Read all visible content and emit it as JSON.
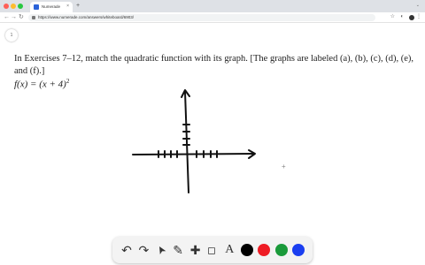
{
  "browser": {
    "tab_title": "Numerade",
    "tab_close": "×",
    "new_tab": "+",
    "url": "https://www.numerade.com/answers/whiteboard/6903/",
    "nav_back": "←",
    "nav_forward": "→",
    "nav_reload": "↻",
    "bookmark_star": "☆",
    "menu": "⋮"
  },
  "page": {
    "page_number": "1",
    "problem_text": "In Exercises 7–12, match the quadratic function with its graph. [The graphs are labeled (a), (b), (c), (d), (e), and (f).]",
    "equation_lhs": "f(x) = (x + 4)",
    "equation_exp": "2",
    "cursor_crosshair": "+"
  },
  "whiteboard_toolbar": {
    "undo": "↶",
    "redo": "↷",
    "select": "➤",
    "pen": "✎",
    "add": "✚",
    "eraser": "◇",
    "text": "A",
    "colors": [
      "#000000",
      "#ee1c24",
      "#1a9a3a",
      "#1a3ef0"
    ]
  },
  "colors": {
    "tabbar_bg": "#dee1e6",
    "ink": "#111111"
  }
}
